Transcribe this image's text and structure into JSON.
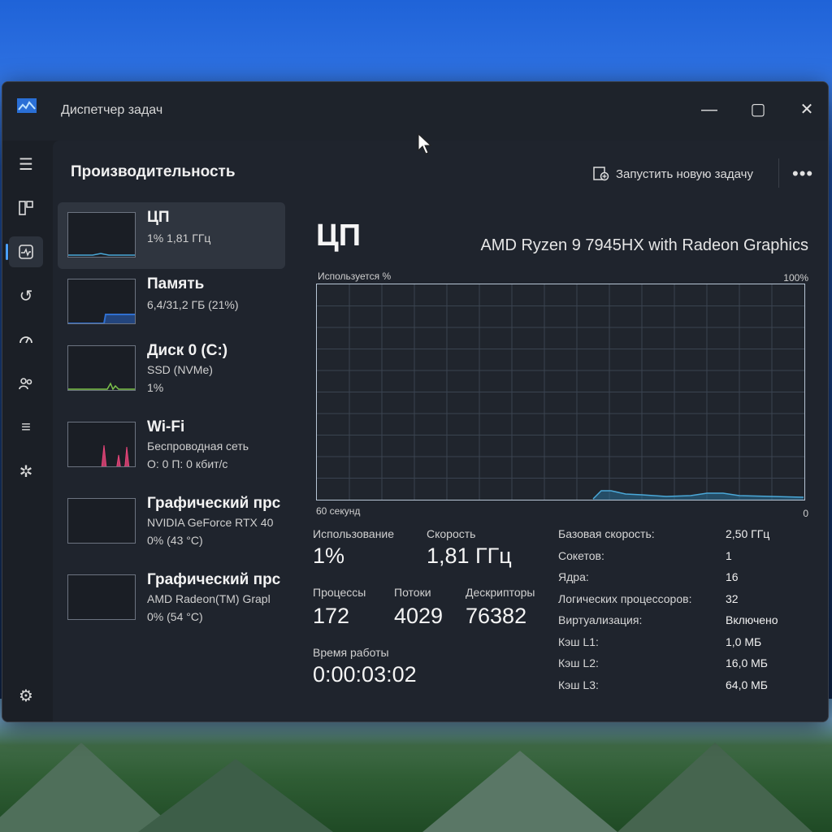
{
  "window": {
    "title": "Диспетчер задач",
    "minimize": "—",
    "maximize": "▢",
    "close": "✕"
  },
  "nav": [
    "menu-icon",
    "processes-icon",
    "performance-icon",
    "app-history-icon",
    "startup-icon",
    "users-icon",
    "details-icon",
    "services-icon",
    "settings-icon"
  ],
  "header": {
    "title": "Производительность",
    "run_task": "Запустить новую задачу",
    "more": "•••"
  },
  "devices": [
    {
      "name": "ЦП",
      "line1": "1% 1,81 ГГц",
      "line2": ""
    },
    {
      "name": "Память",
      "line1": "6,4/31,2 ГБ (21%)",
      "line2": ""
    },
    {
      "name": "Диск 0 (C:)",
      "line1": "SSD (NVMe)",
      "line2": "1%"
    },
    {
      "name": "Wi-Fi",
      "line1": "Беспроводная сеть",
      "line2": "О: 0 П: 0 кбит/с"
    },
    {
      "name": "Графический прс",
      "line1": "NVIDIA GeForce RTX 40",
      "line2": "0% (43 °C)"
    },
    {
      "name": "Графический прс",
      "line1": "AMD Radeon(TM) Grapl",
      "line2": "0% (54 °C)"
    }
  ],
  "detail": {
    "title": "ЦП",
    "model": "AMD Ryzen 9 7945HX with Radeon Graphics",
    "used_label": "Используется %",
    "max_label": "100%",
    "time_label": "60 секунд",
    "zero_label": "0",
    "stats": {
      "usage_label": "Использование",
      "usage": "1%",
      "speed_label": "Скорость",
      "speed": "1,81 ГГц",
      "processes_label": "Процессы",
      "processes": "172",
      "threads_label": "Потоки",
      "threads": "4029",
      "handles_label": "Дескрипторы",
      "handles": "76382",
      "uptime_label": "Время работы",
      "uptime": "0:00:03:02"
    },
    "specs": [
      {
        "label": "Базовая скорость:",
        "value": "2,50 ГГц"
      },
      {
        "label": "Сокетов:",
        "value": "1"
      },
      {
        "label": "Ядра:",
        "value": "16"
      },
      {
        "label": "Логических процессоров:",
        "value": "32"
      },
      {
        "label": "Виртуализация:",
        "value": "Включено"
      },
      {
        "label": "Кэш L1:",
        "value": "1,0 МБ"
      },
      {
        "label": "Кэш L2:",
        "value": "16,0 МБ"
      },
      {
        "label": "Кэш L3:",
        "value": "64,0 МБ"
      }
    ]
  },
  "colors": {
    "cpu": "#4aa8d8",
    "memory": "#2f6fd0",
    "disk": "#7cc24a",
    "wifi": "#e8457a"
  }
}
